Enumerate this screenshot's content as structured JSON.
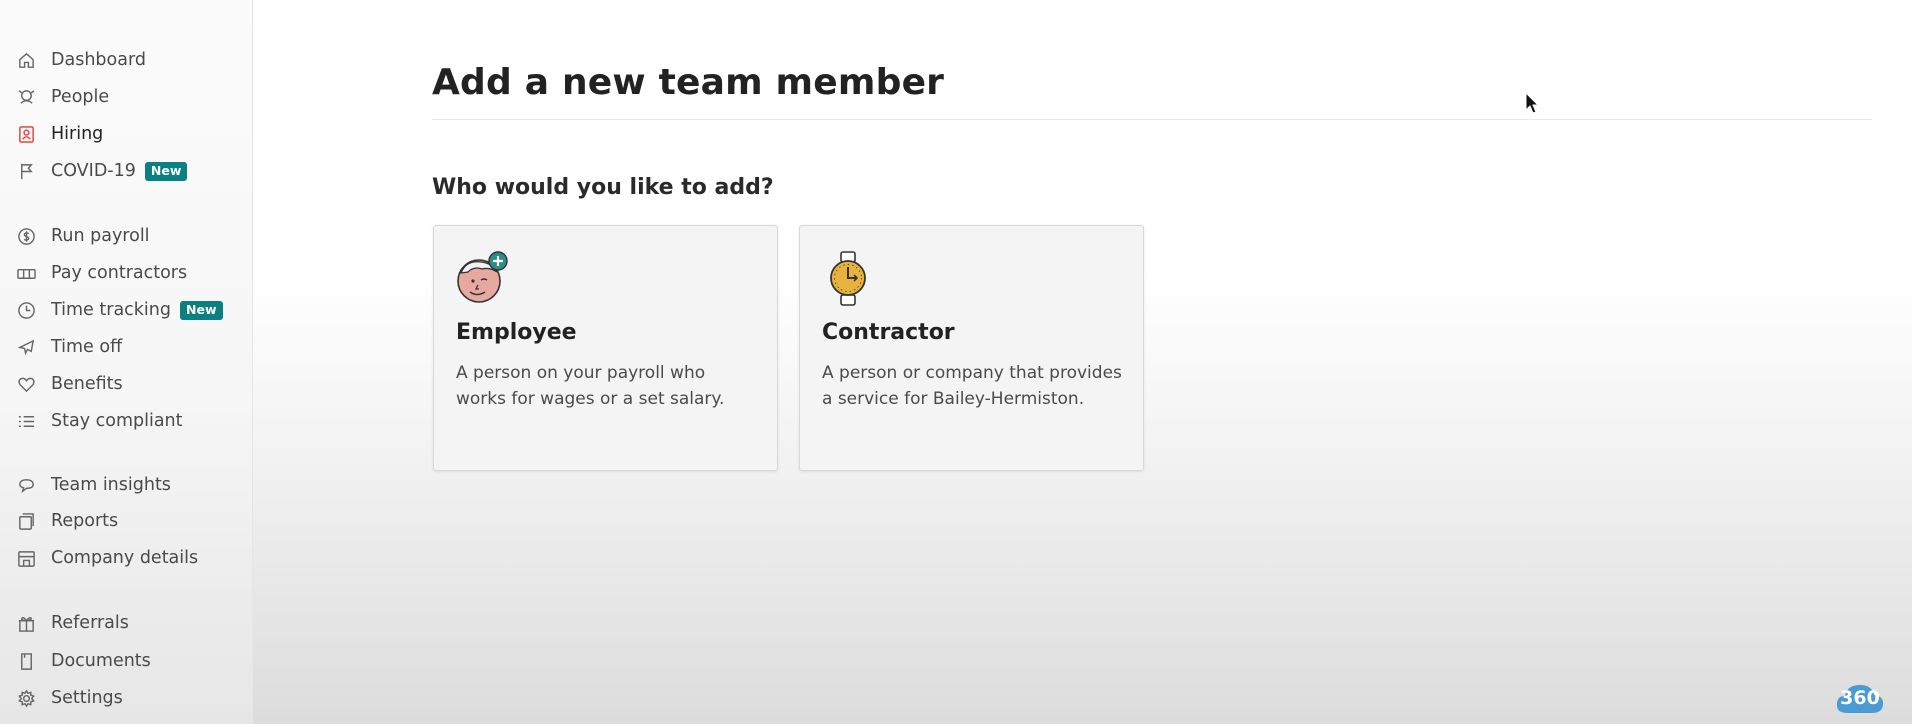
{
  "sidebar": {
    "items": [
      {
        "label": "Dashboard",
        "icon": "home-icon"
      },
      {
        "label": "People",
        "icon": "people-icon"
      },
      {
        "label": "Hiring",
        "icon": "hiring-icon",
        "active": true
      },
      {
        "label": "COVID-19",
        "icon": "flag-icon",
        "badge": "New"
      },
      {
        "label": "Run payroll",
        "icon": "dollar-icon"
      },
      {
        "label": "Pay contractors",
        "icon": "pay-contractors-icon"
      },
      {
        "label": "Time tracking",
        "icon": "clock-icon",
        "badge": "New"
      },
      {
        "label": "Time off",
        "icon": "plane-icon"
      },
      {
        "label": "Benefits",
        "icon": "heart-icon"
      },
      {
        "label": "Stay compliant",
        "icon": "checklist-icon"
      },
      {
        "label": "Team insights",
        "icon": "chat-bubble-icon"
      },
      {
        "label": "Reports",
        "icon": "reports-icon"
      },
      {
        "label": "Company details",
        "icon": "building-icon"
      },
      {
        "label": "Referrals",
        "icon": "gift-icon"
      },
      {
        "label": "Documents",
        "icon": "document-icon"
      },
      {
        "label": "Settings",
        "icon": "gear-icon"
      }
    ]
  },
  "main": {
    "title": "Add a new team member",
    "question": "Who would you like to add?",
    "cards": [
      {
        "title": "Employee",
        "description": "A person on your payroll who works for wages or a set salary.",
        "icon": "employee-face-plus-icon"
      },
      {
        "title": "Contractor",
        "description": "A person or company that provides a service for Bailey-Hermiston.",
        "icon": "stopwatch-icon"
      }
    ]
  },
  "watermark": {
    "text": "360"
  },
  "colors": {
    "badge": "#0a8080",
    "hiring_accent": "#e0574a",
    "watermark": "#4a9bd3"
  }
}
